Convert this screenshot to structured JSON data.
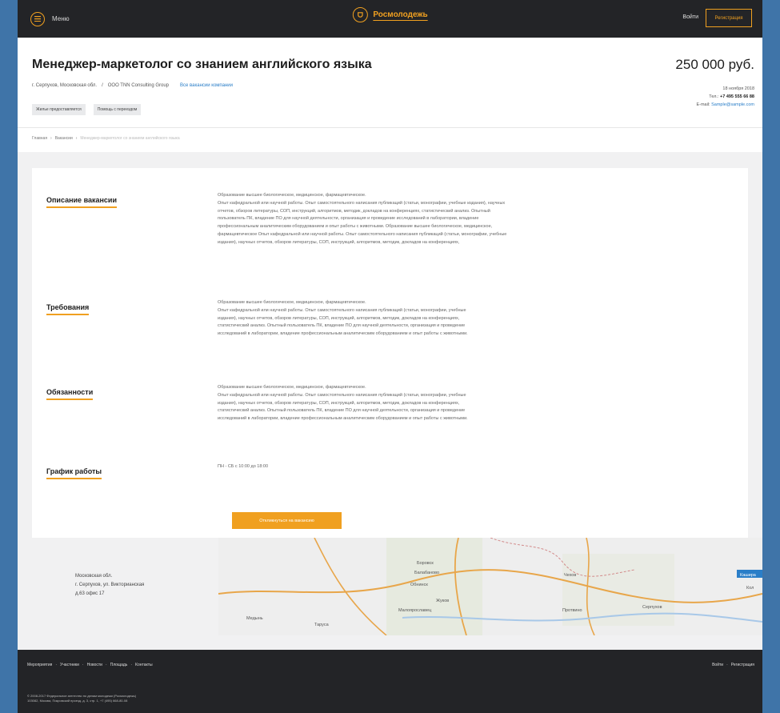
{
  "header": {
    "menu_label": "Меню",
    "logo_text": "Росмолодежь",
    "login": "Войти",
    "register": "Регистрация"
  },
  "job": {
    "title": "Менеджер-маркетолог со знанием английского языка",
    "location": "г. Серпухов, Московская обл.",
    "separator": "/",
    "company": "OOO TNN Consulting Group",
    "all_vacancies": "Все вакансии компании",
    "tags": [
      "Жилье предоставляется",
      "Помощь с переездом"
    ],
    "salary": "250 000 руб.",
    "date": "18 ноября 2018",
    "phone_label": "Тел.:",
    "phone": "+7 495 555 66 88",
    "email_label": "E-mail:",
    "email": "Sample@sample.com"
  },
  "breadcrumb": {
    "home": "Главная",
    "sep": "›",
    "vacancies": "Вакансии",
    "current": "Менеджер-маркетолог со знанием английского языка"
  },
  "sections": [
    {
      "title": "Описание вакансии",
      "lines": [
        "Образование высшее биологическое, медицинское, фармацевтическое.",
        "Опыт кафедральной или научной работы. Опыт самостоятельного написания публикаций (статьи, монографии, учебные издания), научных",
        "отчетов, обзоров литературы, СОП, инструкций, алгоритмов, методик, докладов на конференциях, статистический анализ. Опытный",
        "пользователь ПК, владение ПО для научной деятельности, организация и проведение исследований в лаборатории, владение",
        "профессиональным аналитическим оборудованием и опыт работы с животными.   Образование высшее биологическое, медицинское,",
        "фармацевтическое Опыт кафедральной или научной работы. Опыт самостоятельного написания публикаций (статьи, монографии, учебные",
        "издания), научных отчетов, обзоров литературы, СОП, инструкций, алгоритмов, методик, докладов на конференциях,"
      ]
    },
    {
      "title": "Требования",
      "lines": [
        "Образование высшее биологическое, медицинское, фармацевтическое.",
        "Опыт кафедральной или научной работы. Опыт самостоятельного написания публикаций (статьи, монографии, учебные",
        "издания), научных отчетов, обзоров литературы, СОП, инструкций, алгоритмов, методик, докладов на конференциях,",
        "статистический анализ. Опытный пользователь ПК, владение ПО для научной деятельности, организация и проведение",
        "исследований в лаборатории, владение профессиональным аналитическим оборудованием и опыт работы с животными."
      ]
    },
    {
      "title": "Обязанности",
      "lines": [
        "Образование высшее биологическое, медицинское, фармацевтическое.",
        "Опыт кафедральной или научной работы. Опыт самостоятельного написания публикаций (статьи, монографии, учебные",
        "издания), научных отчетов, обзоров литературы, СОП, инструкций, алгоритмов, методик, докладов на конференциях,",
        "статистический анализ. Опытный пользователь ПК, владение ПО для научной деятельности, организация и проведение",
        "исследований в лаборатории, владение профессиональным аналитическим оборудованием и опыт работы с животными."
      ]
    },
    {
      "title": "График работы",
      "lines": [
        "ПН - СБ с 10:00 до 18:00"
      ]
    }
  ],
  "apply_button": "Откликнуться на вакансию",
  "address": {
    "line1": "Московская обл.",
    "line2": "г. Серпухов, ул. Викторианская",
    "line3": "д.63 офис 17"
  },
  "map": {
    "labels": [
      "Боровск",
      "Балабаново",
      "Обнинск",
      "Чехов",
      "Малоярославец",
      "Жуков",
      "Протвино",
      "Серпухов",
      "Кашира",
      "Медынь",
      "Таруса",
      "Кол"
    ],
    "colors": {
      "road": "#e8a64a",
      "border": "#d28a8a",
      "water": "#a8c8e8",
      "land": "#eeeeee"
    }
  },
  "footer": {
    "links": [
      "Мероприятия",
      "Участники",
      "Новости",
      "Площадь",
      "Контакты"
    ],
    "bullet": "·",
    "right_links": [
      "Войти",
      "Регистрация"
    ],
    "copyright_1": "© 2008-2017 Федеральное агентство по делам молодежи (Росмолодежь)",
    "copyright_2": "103082, Москва, Покровский проезд, д. 3, стр. 1, +7 (495) 668-80-08"
  },
  "colors": {
    "accent": "#f0a020",
    "dark": "#232427",
    "link": "#2a7ec8",
    "frame": "#3f74a8"
  }
}
